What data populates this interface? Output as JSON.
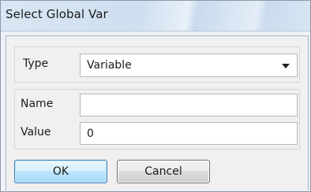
{
  "window": {
    "title": "Select Global Var"
  },
  "type_group": {
    "label": "Type",
    "selected": "Variable"
  },
  "fields": {
    "name": {
      "label": "Name",
      "value": ""
    },
    "value": {
      "label": "Value",
      "value": "0"
    }
  },
  "buttons": {
    "ok_label": "OK",
    "cancel_label": "Cancel"
  },
  "colors": {
    "title_bar": "#d5e3f2",
    "dialog_bg": "#f0f0f0",
    "default_button_border": "#3c7fb1"
  }
}
